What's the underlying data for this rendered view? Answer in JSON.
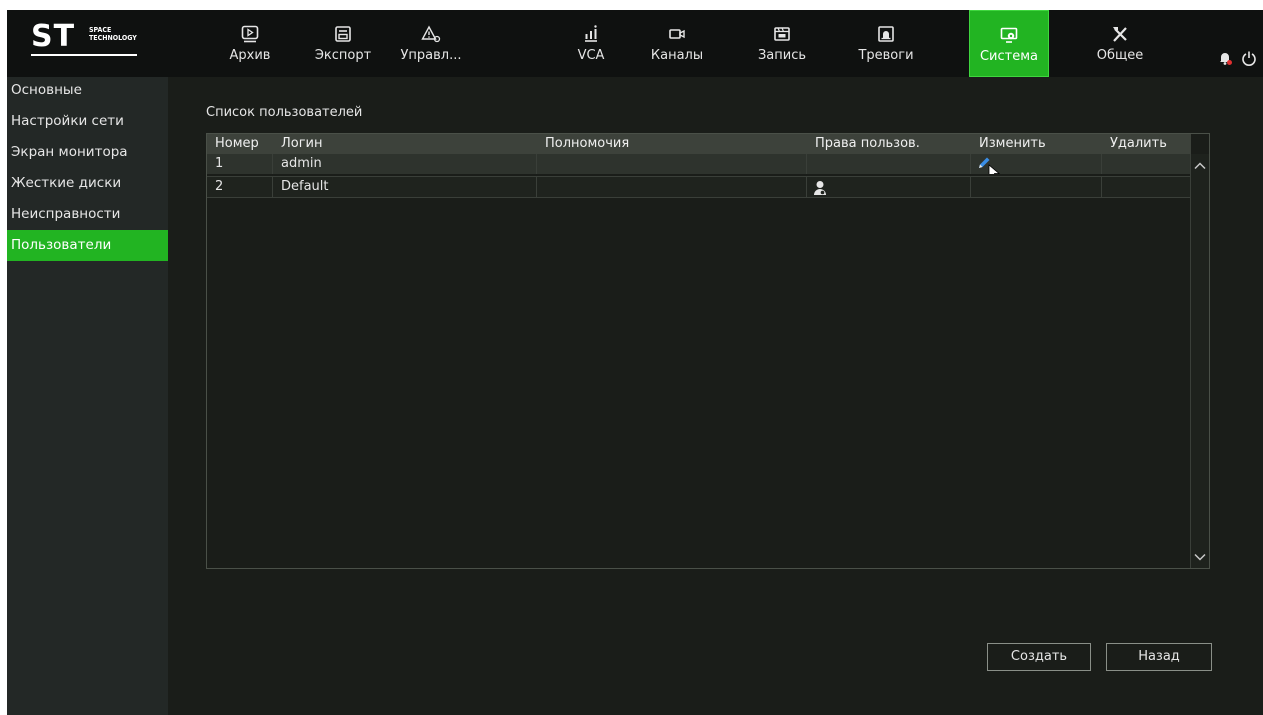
{
  "brand": {
    "logo_text": "ST",
    "logo_sub_1": "SPACE",
    "logo_sub_2": "TECHNOLOGY"
  },
  "tabs": [
    {
      "label": "Архив",
      "icon": "play-box-icon"
    },
    {
      "label": "Экспорт",
      "icon": "floppy-icon"
    },
    {
      "label": "Управл...",
      "icon": "warning-gear-icon"
    },
    {
      "label": "VCA",
      "icon": "vca-chart-icon"
    },
    {
      "label": "Каналы",
      "icon": "camera-icon"
    },
    {
      "label": "Запись",
      "icon": "record-icon"
    },
    {
      "label": "Тревоги",
      "icon": "alarm-icon"
    },
    {
      "label": "Система",
      "icon": "system-monitor-icon",
      "active": true
    },
    {
      "label": "Общее",
      "icon": "tools-icon"
    }
  ],
  "sidebar": {
    "items": [
      {
        "label": "Основные"
      },
      {
        "label": "Настройки сети"
      },
      {
        "label": "Экран монитора"
      },
      {
        "label": "Жесткие диски"
      },
      {
        "label": "Неисправности"
      },
      {
        "label": "Пользователи",
        "active": true
      }
    ]
  },
  "main": {
    "title": "Список пользователей",
    "columns": [
      "Номер",
      "Логин",
      "Полномочия",
      "Права пользов.",
      "Изменить",
      "Удалить"
    ],
    "rows": [
      {
        "num": "1",
        "login": "admin",
        "rights": "",
        "user_rights_icon": "",
        "edit_icon": "pencil-icon",
        "delete": ""
      },
      {
        "num": "2",
        "login": "Default",
        "rights": "",
        "user_rights_icon": "user-icon",
        "edit_icon": "",
        "delete": ""
      }
    ]
  },
  "buttons": {
    "create": "Создать",
    "back": "Назад"
  },
  "colors": {
    "accent": "#22b422",
    "background": "#1a1d19",
    "sidebar": "#232826",
    "topbar": "#0f1110"
  }
}
